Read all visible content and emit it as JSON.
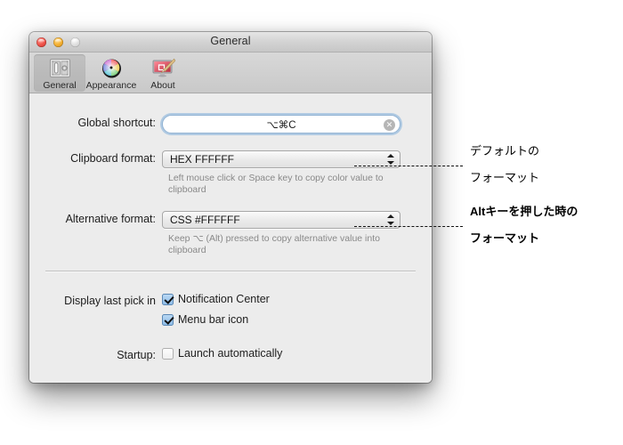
{
  "window": {
    "title": "General",
    "controls": {
      "close": "close-button",
      "minimize": "minimize-button",
      "zoom": "zoom-button"
    }
  },
  "toolbar": {
    "items": [
      {
        "label": "General",
        "icon": "general-switch-icon",
        "selected": true
      },
      {
        "label": "Appearance",
        "icon": "color-wheel-icon",
        "selected": false
      },
      {
        "label": "About",
        "icon": "monitor-paintbrush-icon",
        "selected": false
      }
    ]
  },
  "form": {
    "global_shortcut": {
      "label": "Global shortcut:",
      "value": "⌥⌘C",
      "clear_icon": "clear-circle-icon"
    },
    "clipboard_format": {
      "label": "Clipboard format:",
      "value": "HEX FFFFFF",
      "help": "Left mouse click or Space key to copy color value to clipboard"
    },
    "alternative_format": {
      "label": "Alternative format:",
      "value": "CSS #FFFFFF",
      "help": "Keep ⌥ (Alt) pressed to copy alternative value into clipboard"
    },
    "display_last_pick": {
      "label": "Display last pick in",
      "options": [
        {
          "label": "Notification Center",
          "checked": true
        },
        {
          "label": "Menu bar icon",
          "checked": true
        }
      ]
    },
    "startup": {
      "label": "Startup:",
      "options": [
        {
          "label": "Launch automatically",
          "checked": false
        }
      ]
    }
  },
  "annotations": [
    {
      "line1": "デフォルトの",
      "line2": "フォーマット"
    },
    {
      "line1": "Altキーを押した時の",
      "line2": "フォーマット"
    }
  ],
  "colors": {
    "accent": "#6ea5d7",
    "window_bg": "#ececec",
    "checkbox_on": "#8fbde9"
  }
}
